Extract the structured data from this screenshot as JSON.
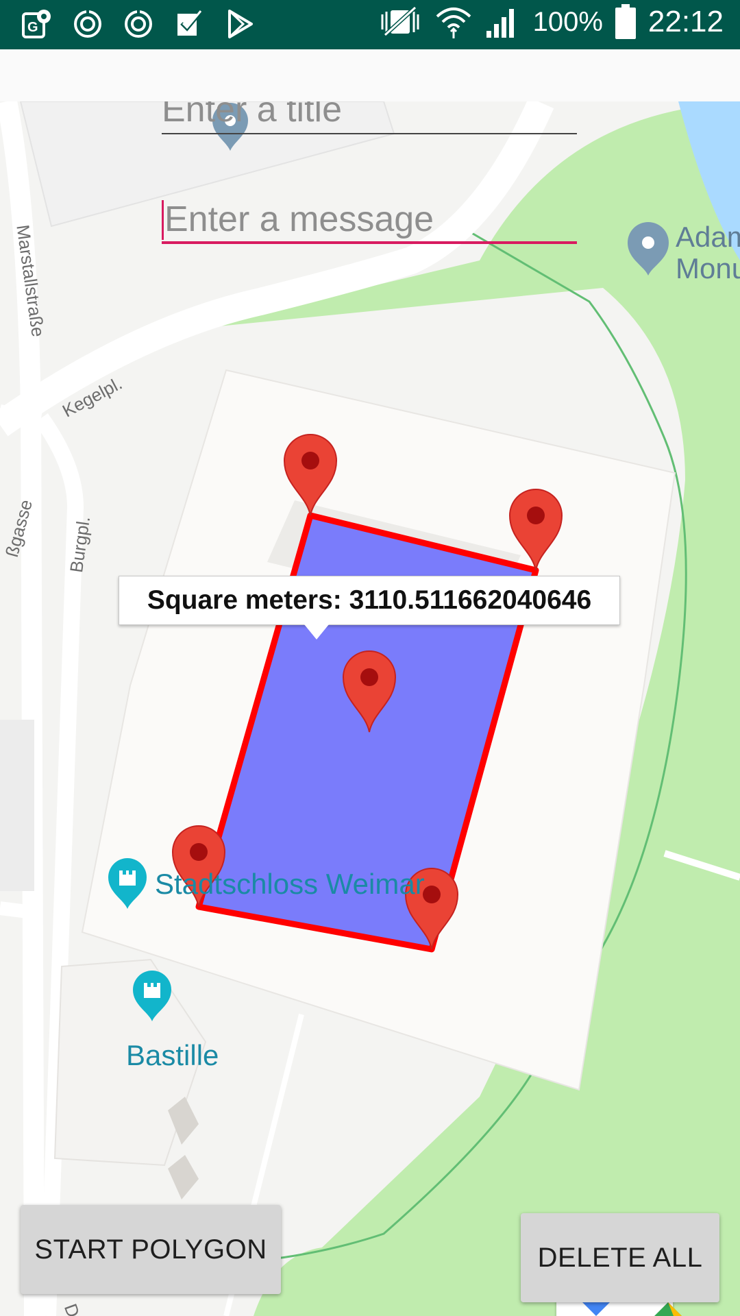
{
  "status_bar": {
    "battery": "100%",
    "time": "22:12",
    "left_icons": [
      "location-settings-icon",
      "sync-icon",
      "sync-icon-2",
      "task-check-icon",
      "play-store-icon"
    ],
    "right_icons": [
      "vibrate-icon",
      "wifi-icon",
      "signal-icon",
      "battery-icon"
    ]
  },
  "form": {
    "title_placeholder": "Enter a title",
    "message_placeholder": "Enter a message"
  },
  "map": {
    "info_window": "Square meters: 3110.511662040646",
    "poi_labels": {
      "stadtschloss": "Stadtschloss Weimar",
      "bastille": "Bastille",
      "adam_line1": "Adam",
      "adam_line2": "Monu"
    },
    "streets": {
      "marstallstrasse": "Marstallstraße",
      "kegelpl": "Kegelpl.",
      "burgpl": "Burgpl.",
      "gasse": "ßgasse",
      "bottom_street": "De"
    },
    "polygon_fill": "#7a7cfb",
    "polygon_stroke": "#ff0000",
    "marker_color": "#ea4335"
  },
  "buttons": {
    "start_polygon": "START POLYGON",
    "delete_all": "DELETE ALL"
  }
}
